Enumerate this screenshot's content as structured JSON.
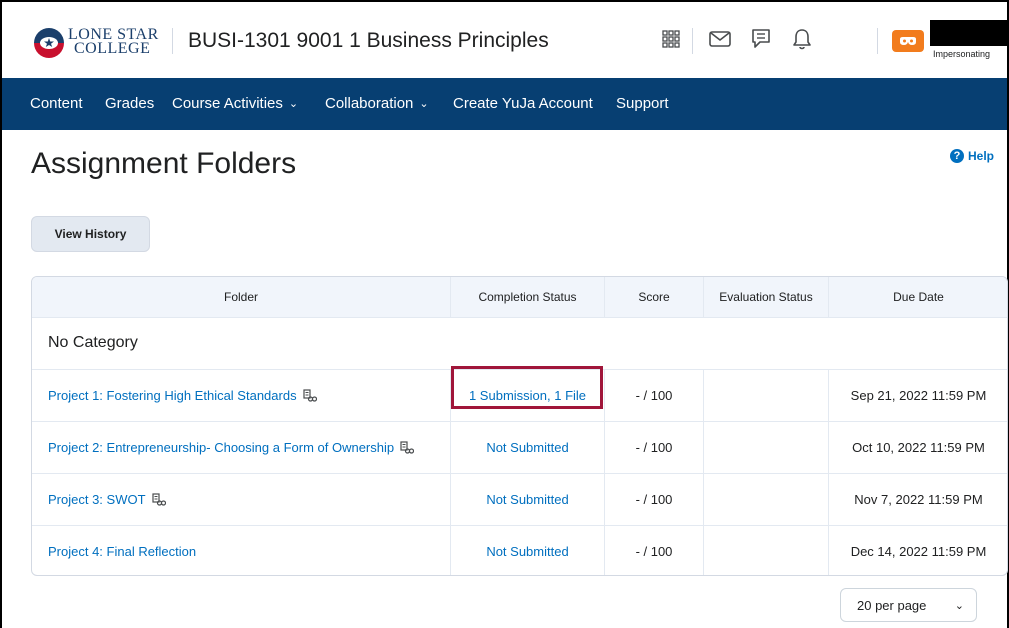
{
  "header": {
    "logo_line1": "LONE STAR",
    "logo_line2": "COLLEGE",
    "course_title": "BUSI-1301 9001 1 Business Principles",
    "impersonating_label": "Impersonating",
    "icons": [
      "grid-icon",
      "mail-icon",
      "chat-icon",
      "bell-icon",
      "mask-icon"
    ],
    "avatar_color": "#f27c1d"
  },
  "nav": {
    "bg_color": "#073f72",
    "items": [
      {
        "label": "Content"
      },
      {
        "label": "Grades"
      },
      {
        "label": "Course Activities",
        "dropdown": true
      },
      {
        "label": "Collaboration",
        "dropdown": true
      },
      {
        "label": "Create YuJa Account"
      },
      {
        "label": "Support"
      }
    ]
  },
  "page": {
    "title": "Assignment Folders",
    "help_label": "Help",
    "view_history_label": "View History"
  },
  "table": {
    "headers": [
      "Folder",
      "Completion Status",
      "Score",
      "Evaluation Status",
      "Due Date"
    ],
    "category": "No Category",
    "rows": [
      {
        "folder": "Project 1: Fostering High Ethical Standards",
        "rubric": true,
        "status": "1 Submission, 1 File",
        "score": "- / 100",
        "evaluation": "",
        "due": "Sep 21, 2022 11:59 PM"
      },
      {
        "folder": "Project 2: Entrepreneurship- Choosing a Form of Ownership",
        "rubric": true,
        "status": "Not Submitted",
        "score": "- / 100",
        "evaluation": "",
        "due": "Oct 10, 2022 11:59 PM"
      },
      {
        "folder": "Project 3: SWOT",
        "rubric": true,
        "status": "Not Submitted",
        "score": "- / 100",
        "evaluation": "",
        "due": "Nov 7, 2022 11:59 PM"
      },
      {
        "folder": "Project 4: Final Reflection",
        "rubric": false,
        "status": "Not Submitted",
        "score": "- / 100",
        "evaluation": "",
        "due": "Dec 14, 2022 11:59 PM"
      }
    ],
    "highlight_color": "#a0163a",
    "link_color": "#006fbf"
  },
  "pagination": {
    "per_page_label": "20 per page"
  }
}
